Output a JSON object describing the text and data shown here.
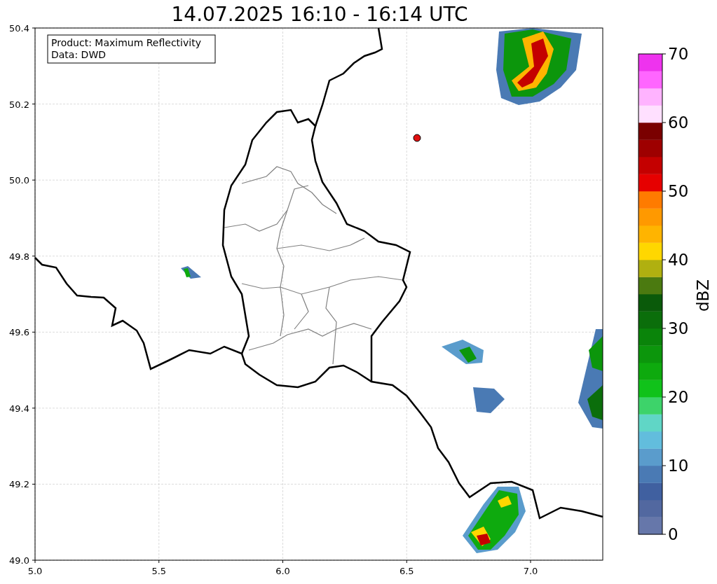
{
  "title": "14.07.2025 16:10 - 16:14 UTC",
  "info_box": {
    "lines": [
      "Product: Maximum Reflectivity",
      "Data: DWD"
    ]
  },
  "map": {
    "x_ticks": [
      "5.0",
      "5.5",
      "6.0",
      "6.5",
      "7.0"
    ],
    "y_ticks": [
      "50.4",
      "50.2",
      "50.0",
      "49.8",
      "49.6",
      "49.4",
      "49.2",
      "49.0"
    ]
  },
  "colorbar": {
    "label": "dBZ",
    "ticks": [
      "70",
      "60",
      "50",
      "40",
      "30",
      "20",
      "10",
      "0"
    ],
    "bins": [
      {
        "color": "#6677aa"
      },
      {
        "color": "#5268a0"
      },
      {
        "color": "#4060a0"
      },
      {
        "color": "#4a7ab4"
      },
      {
        "color": "#5a9ccc"
      },
      {
        "color": "#62bddd"
      },
      {
        "color": "#60d6c6"
      },
      {
        "color": "#3dd36a"
      },
      {
        "color": "#10c21a"
      },
      {
        "color": "#0eaa0e"
      },
      {
        "color": "#0c960c"
      },
      {
        "color": "#0a840a"
      },
      {
        "color": "#0b6e0b"
      },
      {
        "color": "#0a5a0a"
      },
      {
        "color": "#4b7a10"
      },
      {
        "color": "#b0b010"
      },
      {
        "color": "#ffd700"
      },
      {
        "color": "#ffb400"
      },
      {
        "color": "#ff9900"
      },
      {
        "color": "#ff7b00"
      },
      {
        "color": "#e60000"
      },
      {
        "color": "#c40000"
      },
      {
        "color": "#9e0000"
      },
      {
        "color": "#7a0000"
      },
      {
        "color": "#ffe0ff"
      },
      {
        "color": "#ffb3ff"
      },
      {
        "color": "#ff66ff"
      },
      {
        "color": "#ee33ee"
      }
    ]
  }
}
